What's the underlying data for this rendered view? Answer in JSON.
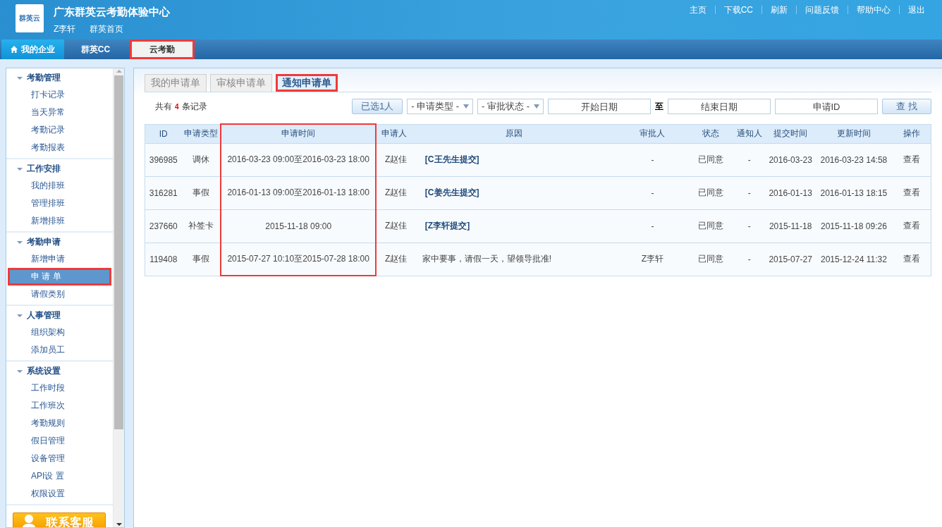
{
  "header": {
    "logo_text": "群英云",
    "title": "广东群英云考勤体验中心",
    "user": "Z李轩",
    "home_link": "群英首页",
    "links": [
      "主页",
      "下载CC",
      "刷新",
      "问题反馈",
      "帮助中心",
      "退出"
    ]
  },
  "nav": [
    {
      "label": "我的企业",
      "kind": "home",
      "selected": false,
      "highlighted": false
    },
    {
      "label": "群英CC",
      "kind": "plain",
      "selected": false,
      "highlighted": false
    },
    {
      "label": "云考勤",
      "kind": "plain",
      "selected": true,
      "highlighted": true
    }
  ],
  "sidebar": {
    "groups": [
      {
        "title": "考勤管理",
        "expanded": true,
        "items": [
          {
            "label": "打卡记录",
            "selected": false,
            "highlighted": false
          },
          {
            "label": "当天异常",
            "selected": false,
            "highlighted": false
          },
          {
            "label": "考勤记录",
            "selected": false,
            "highlighted": false
          },
          {
            "label": "考勤报表",
            "selected": false,
            "highlighted": false
          }
        ]
      },
      {
        "title": "工作安排",
        "expanded": true,
        "items": [
          {
            "label": "我的排班",
            "selected": false,
            "highlighted": false
          },
          {
            "label": "管理排班",
            "selected": false,
            "highlighted": false
          },
          {
            "label": "新增排班",
            "selected": false,
            "highlighted": false
          }
        ]
      },
      {
        "title": "考勤申请",
        "expanded": true,
        "items": [
          {
            "label": "新增申请",
            "selected": false,
            "highlighted": false
          },
          {
            "label": "申 请 单",
            "selected": true,
            "highlighted": true
          },
          {
            "label": "请假类别",
            "selected": false,
            "highlighted": false
          }
        ]
      },
      {
        "title": "人事管理",
        "expanded": true,
        "items": [
          {
            "label": "组织架构",
            "selected": false,
            "highlighted": false
          },
          {
            "label": "添加员工",
            "selected": false,
            "highlighted": false
          }
        ]
      },
      {
        "title": "系统设置",
        "expanded": true,
        "items": [
          {
            "label": "工作时段",
            "selected": false,
            "highlighted": false
          },
          {
            "label": "工作班次",
            "selected": false,
            "highlighted": false
          },
          {
            "label": "考勤规则",
            "selected": false,
            "highlighted": false
          },
          {
            "label": "假日管理",
            "selected": false,
            "highlighted": false
          },
          {
            "label": "设备管理",
            "selected": false,
            "highlighted": false
          },
          {
            "label": "API设 置",
            "selected": false,
            "highlighted": false
          },
          {
            "label": "权限设置",
            "selected": false,
            "highlighted": false
          }
        ]
      }
    ],
    "contact_button": "联系客服"
  },
  "tabs": [
    {
      "label": "我的申请单",
      "selected": false,
      "highlighted": false
    },
    {
      "label": "审核申请单",
      "selected": false,
      "highlighted": false
    },
    {
      "label": "通知申请单",
      "selected": true,
      "highlighted": true
    }
  ],
  "record_count": {
    "prefix": "共有",
    "count": "4",
    "suffix": "条记录"
  },
  "filters": {
    "selected_button": "已选1人",
    "type_select": "- 申请类型 -",
    "status_select": "- 审批状态 -",
    "start_date": {
      "placeholder": "开始日期"
    },
    "range_separator": "至",
    "end_date": {
      "placeholder": "结束日期"
    },
    "id_field": {
      "placeholder": "申请ID"
    },
    "search_button": "查 找"
  },
  "table": {
    "columns": [
      {
        "label": "ID",
        "highlighted": false
      },
      {
        "label": "申请类型",
        "highlighted": false
      },
      {
        "label": "申请时间",
        "highlighted": true
      },
      {
        "label": "申请人",
        "highlighted": false
      },
      {
        "label": "原因",
        "highlighted": false
      },
      {
        "label": "审批人",
        "highlighted": false
      },
      {
        "label": "状态",
        "highlighted": false
      },
      {
        "label": "通知人",
        "highlighted": false
      },
      {
        "label": "提交时间",
        "highlighted": false
      },
      {
        "label": "更新时间",
        "highlighted": false
      },
      {
        "label": "操作",
        "highlighted": false
      }
    ],
    "rows": [
      {
        "id": "396985",
        "type": "调休",
        "time": "2016-03-23 09:00至2016-03-23 18:00",
        "applicant": "Z赵佳",
        "reason": {
          "kind": "tag",
          "text": "[C王先生提交]"
        },
        "approver": "-",
        "status": "已同意",
        "notified": "-",
        "submitted": "2016-03-23",
        "updated": "2016-03-23 14:58",
        "action": "查看"
      },
      {
        "id": "316281",
        "type": "事假",
        "time": "2016-01-13 09:00至2016-01-13 18:00",
        "applicant": "Z赵佳",
        "reason": {
          "kind": "tag",
          "text": "[C姜先生提交]"
        },
        "approver": "-",
        "status": "已同意",
        "notified": "-",
        "submitted": "2016-01-13",
        "updated": "2016-01-13 18:15",
        "action": "查看"
      },
      {
        "id": "237660",
        "type": "补签卡",
        "time": "2015-11-18 09:00",
        "applicant": "Z赵佳",
        "reason": {
          "kind": "tag",
          "text": "[Z李轩提交]"
        },
        "approver": "-",
        "status": "已同意",
        "notified": "-",
        "submitted": "2015-11-18",
        "updated": "2015-11-18 09:26",
        "action": "查看"
      },
      {
        "id": "119408",
        "type": "事假",
        "time": "2015-07-27 10:10至2015-07-28 18:00",
        "applicant": "Z赵佳",
        "reason": {
          "kind": "text",
          "text": "家中要事，请假一天，望领导批准!"
        },
        "approver": "Z李轩",
        "status": "已同意",
        "notified": "-",
        "submitted": "2015-07-27",
        "updated": "2015-12-24 11:32",
        "action": "查看"
      }
    ]
  }
}
